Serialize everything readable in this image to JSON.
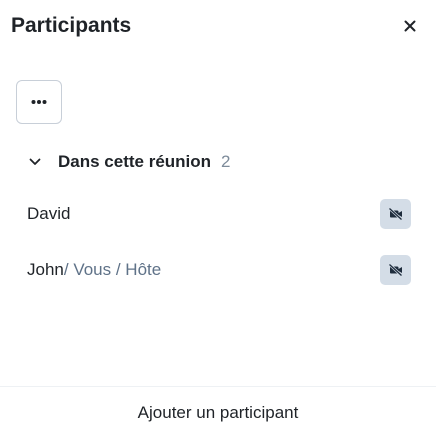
{
  "header": {
    "title": "Participants",
    "close_icon": "close-icon"
  },
  "toolbar": {
    "more_icon": "more-horizontal-icon"
  },
  "section": {
    "title": "Dans cette réunion",
    "count": "2",
    "expanded": true
  },
  "participants": [
    {
      "name": "David",
      "suffix": "",
      "camera_icon": "video-off-icon"
    },
    {
      "name": "John",
      "suffix": "/ Vous / Hôte",
      "camera_icon": "video-off-icon"
    }
  ],
  "footer": {
    "add_label": "Ajouter un participant"
  },
  "colors": {
    "muted": "#5f7288",
    "camera_button_bg": "#d4dde7",
    "border": "#c8cfd8"
  }
}
